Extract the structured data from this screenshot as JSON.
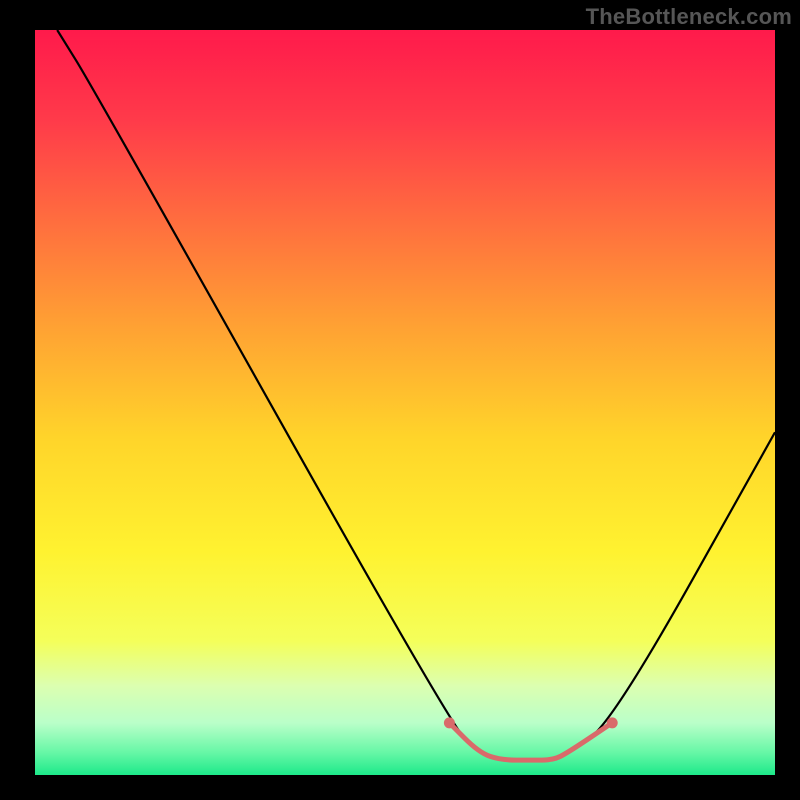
{
  "watermark": "TheBottleneck.com",
  "chart_data": {
    "type": "line",
    "title": "",
    "xlabel": "",
    "ylabel": "",
    "xlim": [
      0,
      100
    ],
    "ylim": [
      0,
      100
    ],
    "background": {
      "type": "vertical-gradient",
      "stops": [
        {
          "offset": 0.0,
          "color": "#ff1a4b"
        },
        {
          "offset": 0.12,
          "color": "#ff3a4a"
        },
        {
          "offset": 0.25,
          "color": "#ff6b3f"
        },
        {
          "offset": 0.4,
          "color": "#ffa233"
        },
        {
          "offset": 0.55,
          "color": "#ffd52a"
        },
        {
          "offset": 0.7,
          "color": "#fff230"
        },
        {
          "offset": 0.82,
          "color": "#f4ff5a"
        },
        {
          "offset": 0.88,
          "color": "#dcffb0"
        },
        {
          "offset": 0.93,
          "color": "#baffc9"
        },
        {
          "offset": 0.97,
          "color": "#66f7a6"
        },
        {
          "offset": 1.0,
          "color": "#1de98a"
        }
      ]
    },
    "series": [
      {
        "name": "curve",
        "x": [
          3,
          8,
          56,
          60,
          63,
          67,
          70,
          72,
          78,
          100
        ],
        "y": [
          100,
          92,
          7,
          3,
          2,
          2,
          2,
          3,
          7,
          46
        ]
      }
    ],
    "highlight_segment": {
      "color": "#d96a6a",
      "x": [
        56,
        60,
        63,
        67,
        70,
        72,
        78
      ],
      "y": [
        7,
        3,
        2,
        2,
        2,
        3,
        7
      ]
    },
    "highlight_points": {
      "color": "#d96a6a",
      "points": [
        {
          "x": 56,
          "y": 7
        },
        {
          "x": 78,
          "y": 7
        }
      ]
    }
  }
}
